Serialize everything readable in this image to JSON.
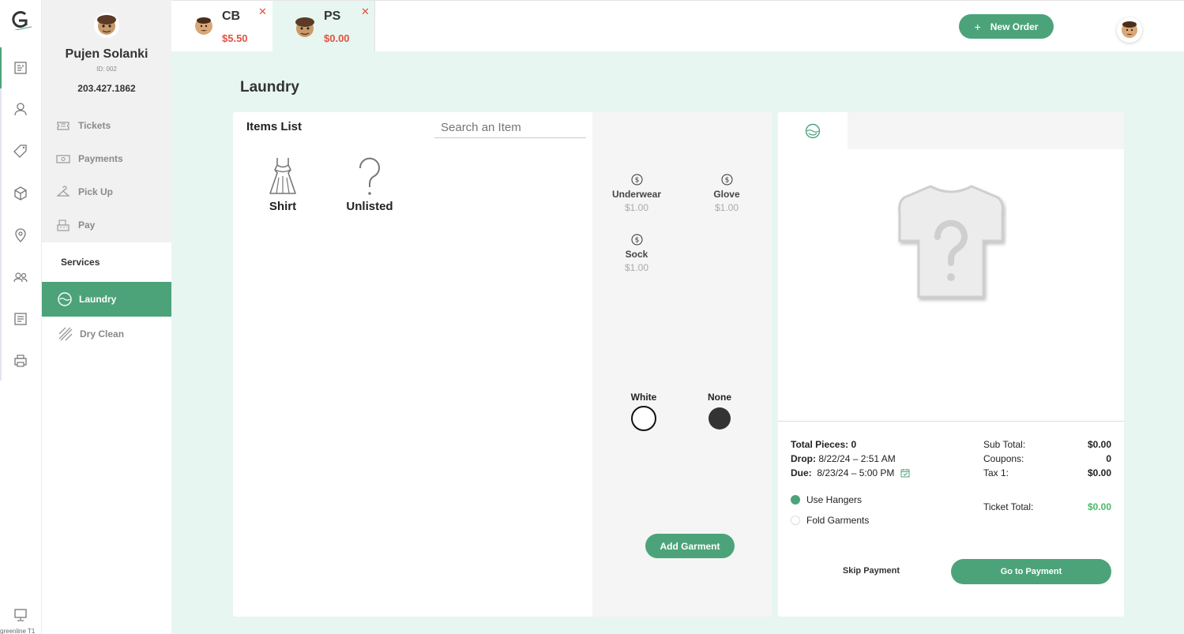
{
  "rail": {
    "icons": [
      "tickets-nav-icon",
      "customer-nav-icon",
      "tag-nav-icon",
      "box-nav-icon",
      "location-nav-icon",
      "team-nav-icon",
      "reports-nav-icon",
      "printer-nav-icon"
    ],
    "footer_text": "greenline T1"
  },
  "customer": {
    "name": "Pujen Solanki",
    "id_label": "ID: 002",
    "phone": "203.427.1862",
    "nav": [
      {
        "label": "Tickets",
        "icon": "ticket-icon"
      },
      {
        "label": "Payments",
        "icon": "cash-icon"
      },
      {
        "label": "Pick Up",
        "icon": "hanger-icon"
      },
      {
        "label": "Pay",
        "icon": "register-icon"
      }
    ]
  },
  "services": {
    "title": "Services",
    "items": [
      {
        "label": "Laundry",
        "icon": "laundry-icon",
        "active": true
      },
      {
        "label": "Dry Clean",
        "icon": "dry-clean-icon",
        "active": false
      }
    ]
  },
  "tabs": [
    {
      "initials": "CB",
      "amount": "$5.50",
      "close": "✕"
    },
    {
      "initials": "PS",
      "amount": "$0.00",
      "close": "✕"
    }
  ],
  "header": {
    "new_order_label": "New Order",
    "new_order_icon": "+"
  },
  "page": {
    "title": "Laundry"
  },
  "items_list": {
    "title": "Items List",
    "search_placeholder": "Search an Item",
    "garments": [
      {
        "label": "Shirt",
        "icon": "dress-icon"
      },
      {
        "label": "Unlisted",
        "icon": "question-icon"
      }
    ]
  },
  "subitems": [
    {
      "name": "Underwear",
      "price": "$1.00"
    },
    {
      "name": "Glove",
      "price": "$1.00"
    },
    {
      "name": "Sock",
      "price": "$1.00"
    }
  ],
  "colors": [
    {
      "name": "White",
      "fill": "#ffffff",
      "border": "#111111"
    },
    {
      "name": "None",
      "fill": "#333333",
      "border": "#333333"
    }
  ],
  "add_garment_label": "Add Garment",
  "ticket": {
    "total_pieces_label": "Total Pieces:",
    "total_pieces_value": "0",
    "drop_label": "Drop:",
    "drop_value": "8/22/24 – 2:51 AM",
    "due_label": "Due:",
    "due_value": "8/23/24 – 5:00 PM",
    "sub_total_label": "Sub Total:",
    "sub_total_value": "$0.00",
    "coupons_label": "Coupons:",
    "coupons_value": "0",
    "tax_label": "Tax 1:",
    "tax_value": "$0.00",
    "ticket_total_label": "Ticket Total:",
    "ticket_total_value": "$0.00",
    "options": [
      {
        "label": "Use Hangers",
        "selected": true
      },
      {
        "label": "Fold Garments",
        "selected": false
      }
    ],
    "skip_payment_label": "Skip Payment",
    "go_to_payment_label": "Go to Payment"
  },
  "colors_theme": {
    "accent": "#4ca37a",
    "danger": "#e05241",
    "background": "#e7f6f0"
  }
}
